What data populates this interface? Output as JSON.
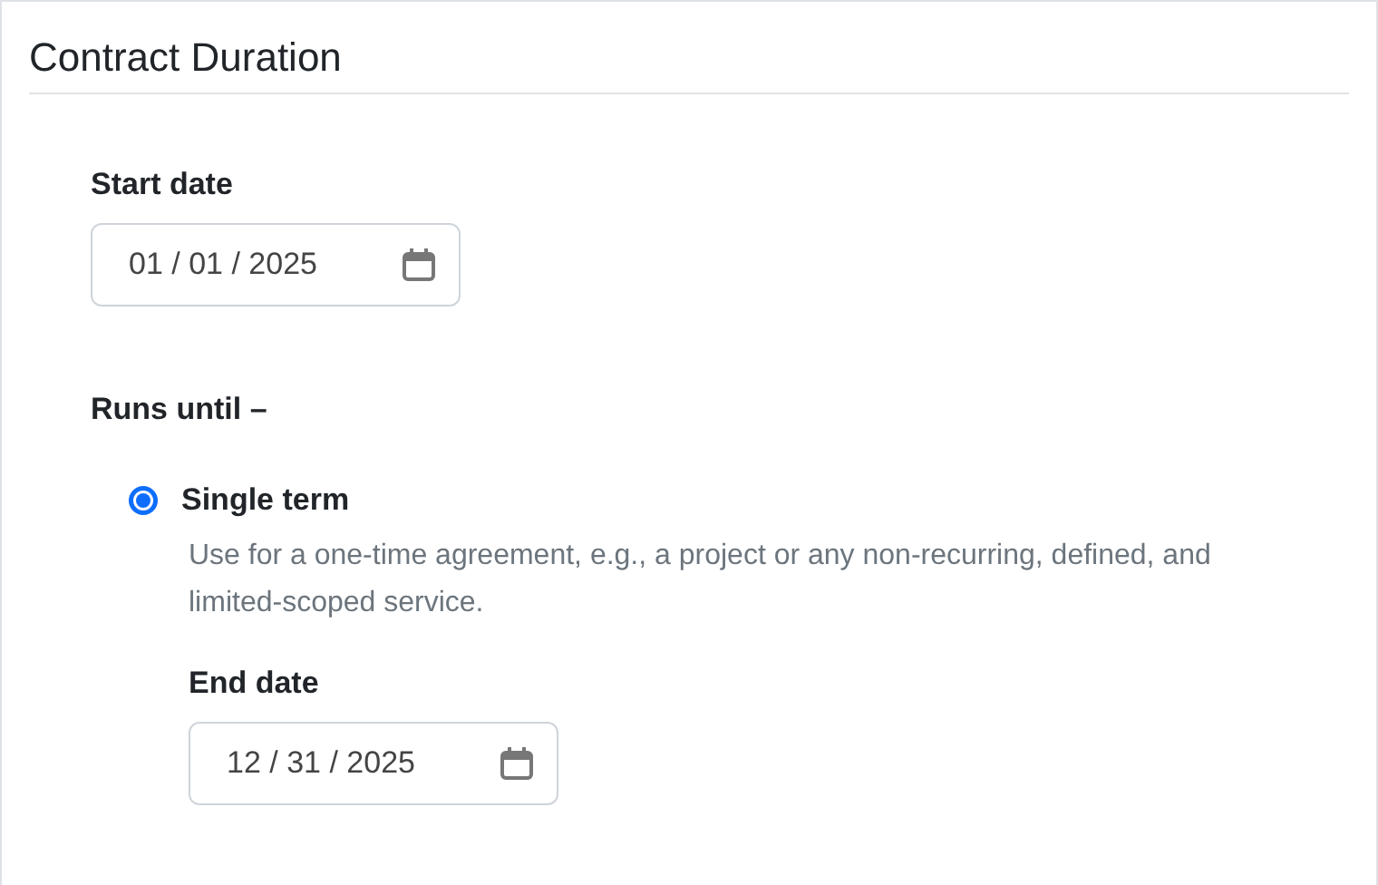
{
  "section": {
    "title": "Contract Duration"
  },
  "start_date": {
    "label": "Start date",
    "value": "01 / 01 / 2025"
  },
  "runs_until": {
    "label": "Runs until –",
    "options": [
      {
        "label": "Single term",
        "selected": true,
        "description": "Use for a one-time agreement, e.g., a project or any non-recurring, defined, and limited-scoped service.",
        "end_date": {
          "label": "End date",
          "value": "12 / 31 / 2025"
        }
      }
    ]
  }
}
